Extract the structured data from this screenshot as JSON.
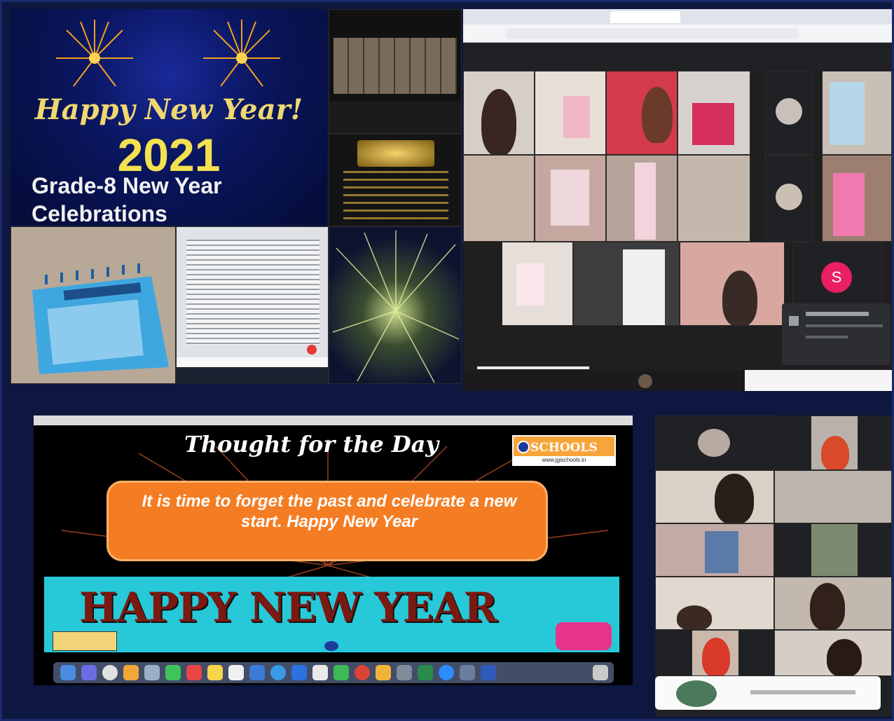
{
  "poster": {
    "headline": "Happy New Year!",
    "year": "2021",
    "subtitle_line1": "Grade-8 New Year",
    "subtitle_line2": "Celebrations"
  },
  "slide": {
    "heading": "Thought for the Day",
    "logo_text": "SCHOOLS",
    "logo_url": "www.jgischools.in",
    "quote": "It is time to forget the past and celebrate a new start. Happy New Year",
    "banner": "HAPPY NEW YEAR"
  },
  "meet_top": {
    "participant_initial": "S"
  },
  "colors": {
    "poster_bg": "#0a1660",
    "poster_gold": "#f3e150",
    "quote_orange": "#f47d24",
    "banner_cyan": "#27c9d8",
    "meet_dark": "#202124",
    "avatar_pink": "#e91e63"
  }
}
